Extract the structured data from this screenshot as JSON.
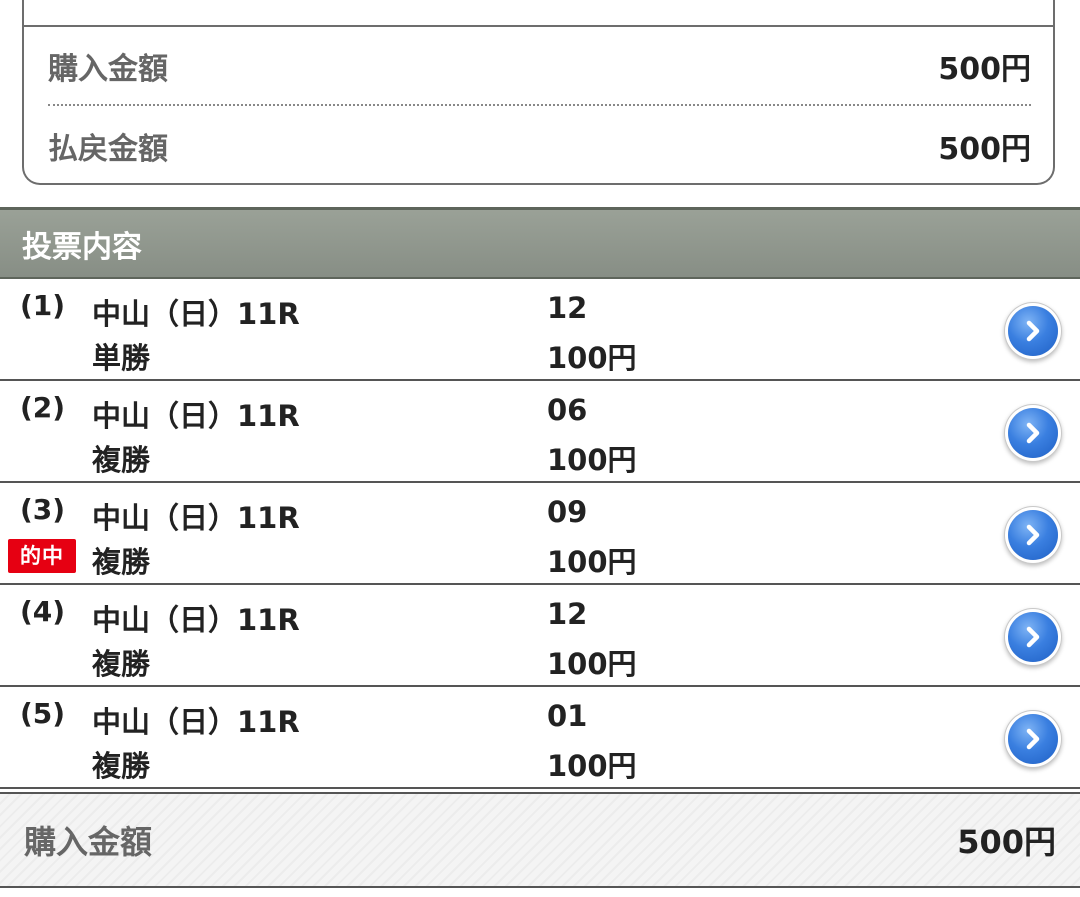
{
  "summary": {
    "purchase_label": "購入金額",
    "purchase_value": "500円",
    "refund_label": "払戻金額",
    "refund_value": "500円"
  },
  "section": {
    "title": "投票内容"
  },
  "bets": [
    {
      "index": "(1)",
      "race": "中山（日）11R",
      "type": "単勝",
      "number": "12",
      "amount": "100円",
      "hit": ""
    },
    {
      "index": "(2)",
      "race": "中山（日）11R",
      "type": "複勝",
      "number": "06",
      "amount": "100円",
      "hit": ""
    },
    {
      "index": "(3)",
      "race": "中山（日）11R",
      "type": "複勝",
      "number": "09",
      "amount": "100円",
      "hit": "的中"
    },
    {
      "index": "(4)",
      "race": "中山（日）11R",
      "type": "複勝",
      "number": "12",
      "amount": "100円",
      "hit": ""
    },
    {
      "index": "(5)",
      "race": "中山（日）11R",
      "type": "複勝",
      "number": "01",
      "amount": "100円",
      "hit": ""
    }
  ],
  "footer": {
    "total_label": "購入金額",
    "total_value": "500円"
  },
  "icons": {
    "detail_arrow": "chevron-right-circle-icon"
  },
  "colors": {
    "hit_badge": "#e60012",
    "header_bg": "#8f968c",
    "arrow_blue": "#2f74d6"
  }
}
